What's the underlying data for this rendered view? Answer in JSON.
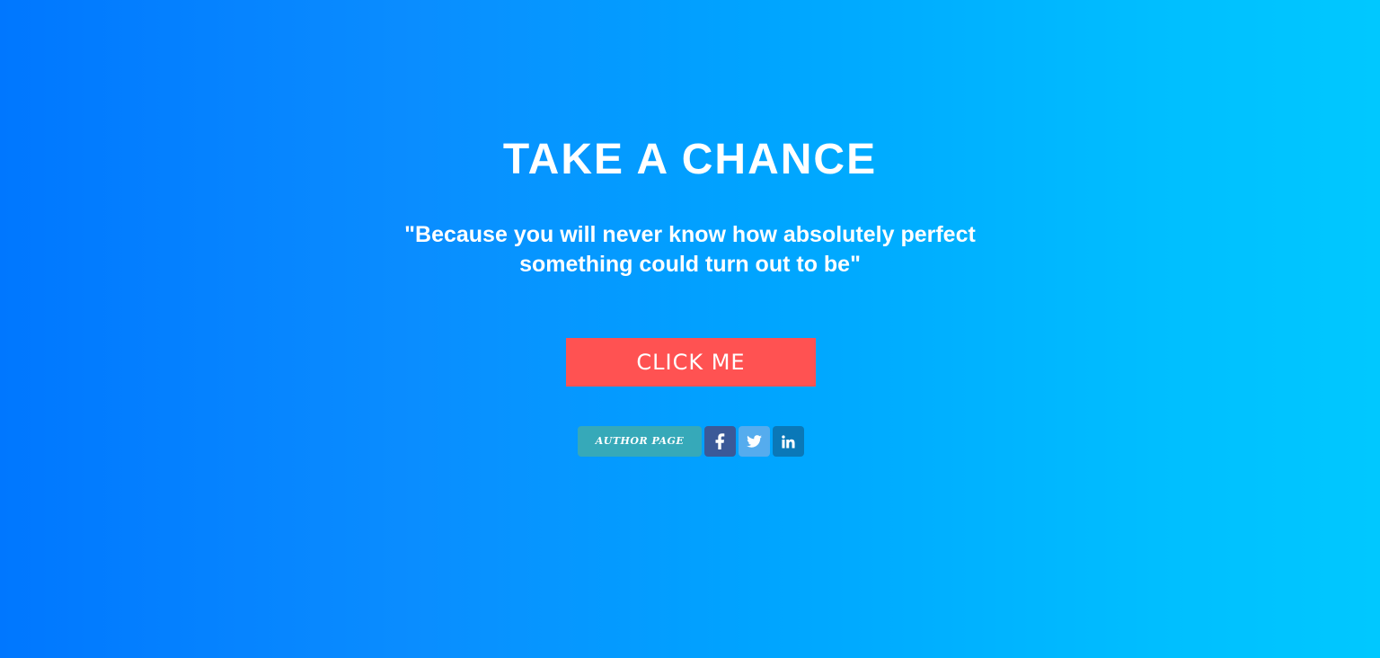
{
  "hero": {
    "title": "TAKE A CHANCE",
    "quote": "\"Because you will never know how absolutely perfect something could turn out to be\"",
    "cta_label": "CLICK ME"
  },
  "social": {
    "author_label": "AUTHOR PAGE",
    "icons": [
      "facebook-icon",
      "twitter-icon",
      "linkedin-icon"
    ]
  },
  "colors": {
    "gradient_start": "#0077ff",
    "gradient_end": "#00c8ff",
    "cta_background": "#ff5252",
    "author_background": "#36a9b9",
    "facebook": "#3b5998",
    "twitter": "#55acee",
    "linkedin": "#0a78b8"
  }
}
